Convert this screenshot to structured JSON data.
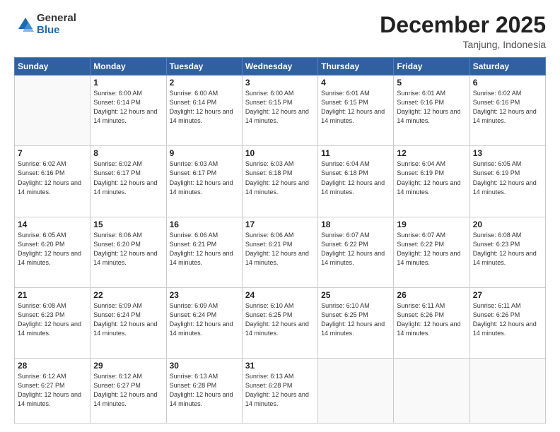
{
  "logo": {
    "general": "General",
    "blue": "Blue"
  },
  "header": {
    "month": "December 2025",
    "location": "Tanjung, Indonesia"
  },
  "weekdays": [
    "Sunday",
    "Monday",
    "Tuesday",
    "Wednesday",
    "Thursday",
    "Friday",
    "Saturday"
  ],
  "weeks": [
    [
      {
        "day": "",
        "info": ""
      },
      {
        "day": "1",
        "info": "Sunrise: 6:00 AM\nSunset: 6:14 PM\nDaylight: 12 hours\nand 14 minutes."
      },
      {
        "day": "2",
        "info": "Sunrise: 6:00 AM\nSunset: 6:14 PM\nDaylight: 12 hours\nand 14 minutes."
      },
      {
        "day": "3",
        "info": "Sunrise: 6:00 AM\nSunset: 6:15 PM\nDaylight: 12 hours\nand 14 minutes."
      },
      {
        "day": "4",
        "info": "Sunrise: 6:01 AM\nSunset: 6:15 PM\nDaylight: 12 hours\nand 14 minutes."
      },
      {
        "day": "5",
        "info": "Sunrise: 6:01 AM\nSunset: 6:16 PM\nDaylight: 12 hours\nand 14 minutes."
      },
      {
        "day": "6",
        "info": "Sunrise: 6:02 AM\nSunset: 6:16 PM\nDaylight: 12 hours\nand 14 minutes."
      }
    ],
    [
      {
        "day": "7",
        "info": "Sunrise: 6:02 AM\nSunset: 6:16 PM\nDaylight: 12 hours\nand 14 minutes."
      },
      {
        "day": "8",
        "info": "Sunrise: 6:02 AM\nSunset: 6:17 PM\nDaylight: 12 hours\nand 14 minutes."
      },
      {
        "day": "9",
        "info": "Sunrise: 6:03 AM\nSunset: 6:17 PM\nDaylight: 12 hours\nand 14 minutes."
      },
      {
        "day": "10",
        "info": "Sunrise: 6:03 AM\nSunset: 6:18 PM\nDaylight: 12 hours\nand 14 minutes."
      },
      {
        "day": "11",
        "info": "Sunrise: 6:04 AM\nSunset: 6:18 PM\nDaylight: 12 hours\nand 14 minutes."
      },
      {
        "day": "12",
        "info": "Sunrise: 6:04 AM\nSunset: 6:19 PM\nDaylight: 12 hours\nand 14 minutes."
      },
      {
        "day": "13",
        "info": "Sunrise: 6:05 AM\nSunset: 6:19 PM\nDaylight: 12 hours\nand 14 minutes."
      }
    ],
    [
      {
        "day": "14",
        "info": "Sunrise: 6:05 AM\nSunset: 6:20 PM\nDaylight: 12 hours\nand 14 minutes."
      },
      {
        "day": "15",
        "info": "Sunrise: 6:06 AM\nSunset: 6:20 PM\nDaylight: 12 hours\nand 14 minutes."
      },
      {
        "day": "16",
        "info": "Sunrise: 6:06 AM\nSunset: 6:21 PM\nDaylight: 12 hours\nand 14 minutes."
      },
      {
        "day": "17",
        "info": "Sunrise: 6:06 AM\nSunset: 6:21 PM\nDaylight: 12 hours\nand 14 minutes."
      },
      {
        "day": "18",
        "info": "Sunrise: 6:07 AM\nSunset: 6:22 PM\nDaylight: 12 hours\nand 14 minutes."
      },
      {
        "day": "19",
        "info": "Sunrise: 6:07 AM\nSunset: 6:22 PM\nDaylight: 12 hours\nand 14 minutes."
      },
      {
        "day": "20",
        "info": "Sunrise: 6:08 AM\nSunset: 6:23 PM\nDaylight: 12 hours\nand 14 minutes."
      }
    ],
    [
      {
        "day": "21",
        "info": "Sunrise: 6:08 AM\nSunset: 6:23 PM\nDaylight: 12 hours\nand 14 minutes."
      },
      {
        "day": "22",
        "info": "Sunrise: 6:09 AM\nSunset: 6:24 PM\nDaylight: 12 hours\nand 14 minutes."
      },
      {
        "day": "23",
        "info": "Sunrise: 6:09 AM\nSunset: 6:24 PM\nDaylight: 12 hours\nand 14 minutes."
      },
      {
        "day": "24",
        "info": "Sunrise: 6:10 AM\nSunset: 6:25 PM\nDaylight: 12 hours\nand 14 minutes."
      },
      {
        "day": "25",
        "info": "Sunrise: 6:10 AM\nSunset: 6:25 PM\nDaylight: 12 hours\nand 14 minutes."
      },
      {
        "day": "26",
        "info": "Sunrise: 6:11 AM\nSunset: 6:26 PM\nDaylight: 12 hours\nand 14 minutes."
      },
      {
        "day": "27",
        "info": "Sunrise: 6:11 AM\nSunset: 6:26 PM\nDaylight: 12 hours\nand 14 minutes."
      }
    ],
    [
      {
        "day": "28",
        "info": "Sunrise: 6:12 AM\nSunset: 6:27 PM\nDaylight: 12 hours\nand 14 minutes."
      },
      {
        "day": "29",
        "info": "Sunrise: 6:12 AM\nSunset: 6:27 PM\nDaylight: 12 hours\nand 14 minutes."
      },
      {
        "day": "30",
        "info": "Sunrise: 6:13 AM\nSunset: 6:28 PM\nDaylight: 12 hours\nand 14 minutes."
      },
      {
        "day": "31",
        "info": "Sunrise: 6:13 AM\nSunset: 6:28 PM\nDaylight: 12 hours\nand 14 minutes."
      },
      {
        "day": "",
        "info": ""
      },
      {
        "day": "",
        "info": ""
      },
      {
        "day": "",
        "info": ""
      }
    ]
  ]
}
